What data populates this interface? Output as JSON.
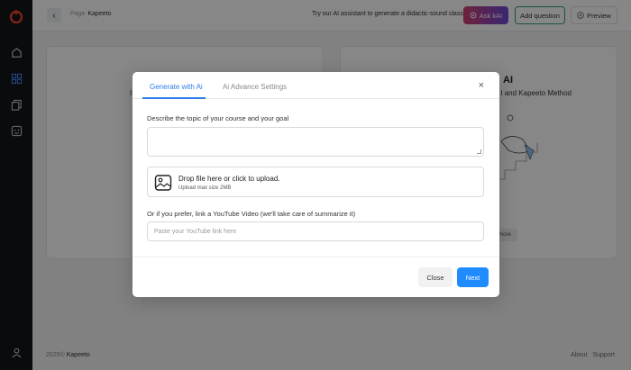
{
  "header": {
    "crumb_page_label": "Page",
    "crumb_current": "Kapeeto",
    "promo_text": "Try our AI assistant to generate a didactic-sound class!",
    "ask_ai_label": "Ask kAI",
    "add_question_label": "Add question",
    "preview_label": "Preview"
  },
  "background": {
    "right_card_title": "AI",
    "right_card_subtitle": "l and Kapeeto Method",
    "right_card_more": "more",
    "left_card_partial": "I"
  },
  "modal": {
    "tabs": [
      {
        "label": "Generate with Ai",
        "active": true
      },
      {
        "label": "Ai Advance Settings",
        "active": false
      }
    ],
    "close_icon": "×",
    "topic_label": "Describe the topic of your course and your goal",
    "topic_value": "",
    "upload_title": "Drop file here or click to upload.",
    "upload_subtitle": "Upload max size 2MB",
    "youtube_label": "Or if you prefer, link a YouTube Video (we'll take care of summarize it)",
    "youtube_placeholder": "Paste your YouTube link here",
    "close_button": "Close",
    "next_button": "Next"
  },
  "footer": {
    "copyright": "2025©",
    "brand": "Kapeeto",
    "about": "About",
    "support": "Support"
  },
  "colors": {
    "accent_blue": "#1f8bff",
    "sidebar_bg": "#14161a",
    "add_question_border": "#2fa36b"
  }
}
